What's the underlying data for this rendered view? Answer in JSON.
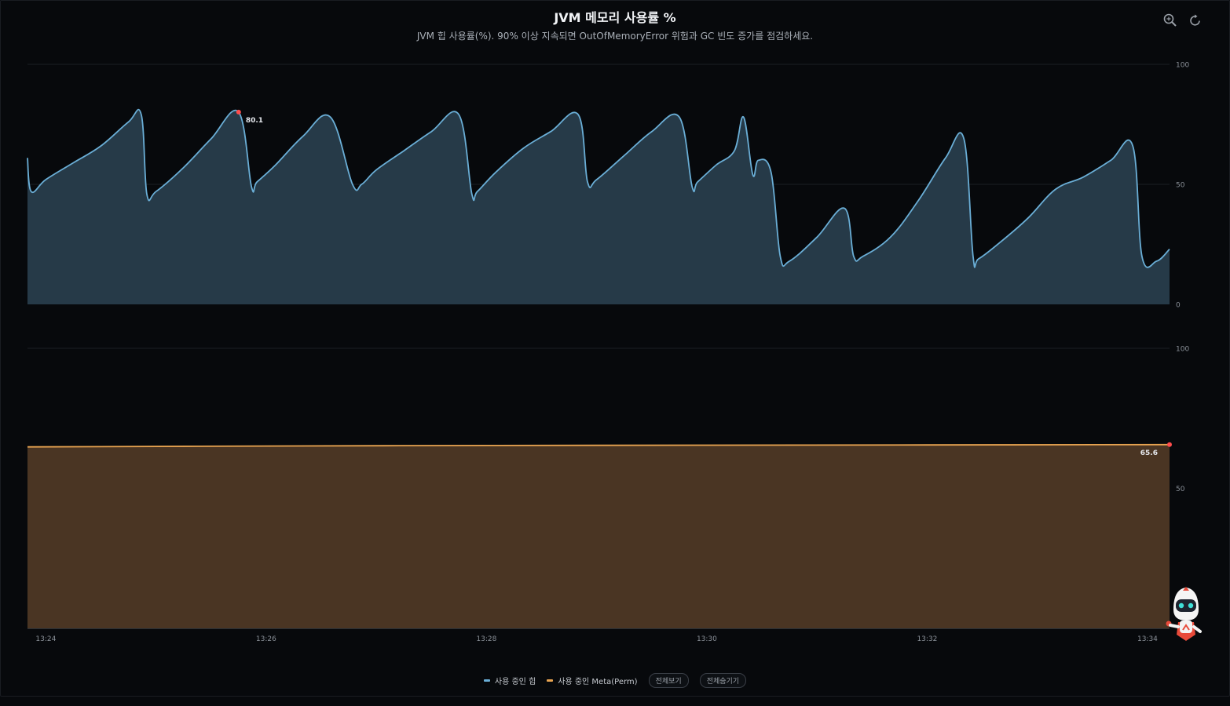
{
  "header": {
    "title": "JVM 메모리 사용률 %",
    "subtitle": "JVM 힙 사용률(%). 90% 이상 지속되면 OutOfMemoryError 위험과 GC 빈도 증가를 점검하세요."
  },
  "toolbar": {
    "zoom_icon": "zoom-icon",
    "reset_icon": "reset-icon"
  },
  "legend": {
    "items": [
      {
        "label": "사용 중인 힙",
        "color": "#6aaed6"
      },
      {
        "label": "사용 중인 Meta(Perm)",
        "color": "#e8a451"
      }
    ],
    "show_all_label": "전체보기",
    "hide_all_label": "전체숨기기"
  },
  "chart_data": [
    {
      "type": "area",
      "series": [
        {
          "name": "사용 중인 힙",
          "color": "#6aaed6",
          "fill": "#263a48",
          "x": [
            "13:23:50",
            "13:23:52",
            "13:24:00",
            "13:24:15",
            "13:24:30",
            "13:24:45",
            "13:24:52",
            "13:24:55",
            "13:25:00",
            "13:25:15",
            "13:25:30",
            "13:25:45",
            "13:25:52",
            "13:25:55",
            "13:26:05",
            "13:26:20",
            "13:26:35",
            "13:26:47",
            "13:26:52",
            "13:27:00",
            "13:27:15",
            "13:27:30",
            "13:27:45",
            "13:27:52",
            "13:27:55",
            "13:28:05",
            "13:28:20",
            "13:28:35",
            "13:28:50",
            "13:28:55",
            "13:29:00",
            "13:29:15",
            "13:29:30",
            "13:29:45",
            "13:29:52",
            "13:29:55",
            "13:30:05",
            "13:30:15",
            "13:30:20",
            "13:30:25",
            "13:30:28",
            "13:30:35",
            "13:30:40",
            "13:30:45",
            "13:31:00",
            "13:31:15",
            "13:31:20",
            "13:31:25",
            "13:31:40",
            "13:31:55",
            "13:32:10",
            "13:32:20",
            "13:32:25",
            "13:32:28",
            "13:32:40",
            "13:32:55",
            "13:33:10",
            "13:33:25",
            "13:33:40",
            "13:33:52",
            "13:33:57",
            "13:34:05",
            "13:34:12"
          ],
          "values": [
            61,
            47,
            52,
            59,
            66,
            76,
            79,
            46,
            47,
            57,
            69,
            80.1,
            49,
            51,
            58,
            70,
            78,
            50,
            50,
            56,
            64,
            72,
            79,
            46,
            47,
            55,
            65,
            72,
            79,
            51,
            52,
            62,
            72,
            78,
            49,
            51,
            58,
            64,
            78,
            54,
            60,
            55,
            20,
            18,
            28,
            40,
            20,
            20,
            28,
            43,
            61,
            69,
            20,
            19,
            26,
            36,
            48,
            53,
            60,
            66,
            20,
            18,
            23
          ]
        }
      ],
      "max_point": {
        "x": "13:25:45",
        "value": 80.1,
        "label": "80.1"
      },
      "x_range": [
        "13:23:50",
        "13:34:12"
      ],
      "ylim": [
        0,
        100
      ],
      "y_ticks": [
        "0",
        "50",
        "100"
      ],
      "grid": true
    },
    {
      "type": "area",
      "series": [
        {
          "name": "사용 중인 Meta(Perm)",
          "color": "#e8a451",
          "fill": "#4a3523",
          "x": [
            "13:23:50",
            "13:26:00",
            "13:28:00",
            "13:30:00",
            "13:32:00",
            "13:34:12"
          ],
          "values": [
            64.8,
            65.1,
            65.3,
            65.4,
            65.5,
            65.6
          ]
        }
      ],
      "max_point": {
        "x": "13:34:12",
        "value": 65.6,
        "label": "65.6"
      },
      "x_range": [
        "13:23:50",
        "13:34:12"
      ],
      "ylim": [
        0,
        100
      ],
      "y_ticks": [
        "50",
        "100"
      ],
      "grid": true
    }
  ],
  "x_axis": {
    "ticks": [
      "13:24",
      "13:26",
      "13:28",
      "13:30",
      "13:32",
      "13:34"
    ]
  }
}
